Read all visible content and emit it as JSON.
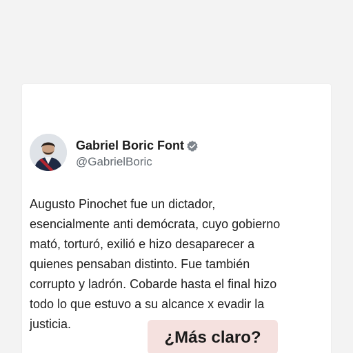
{
  "post": {
    "author_name": "Gabriel Boric Font",
    "author_handle": "@GabrielBoric",
    "verified_icon": "verified-badge-icon",
    "body_lines": [
      "Augusto Pinochet fue un dictador,",
      "esencialmente anti demócrata, cuyo gobierno",
      "mató, torturó, exilió e hizo desaparecer a",
      "quienes pensaban distinto. Fue también",
      "corrupto y ladrón. Cobarde hasta el final hizo",
      "todo lo que estuvo a su alcance x evadir la",
      "justicia."
    ]
  },
  "overlay": {
    "caption": "¿Más claro?",
    "badge_color": "#f5e1df"
  },
  "colors": {
    "background": "#f3f3f3",
    "card": "#ffffff",
    "handle_gray": "#646b72",
    "verified_gray": "#7d848c"
  }
}
